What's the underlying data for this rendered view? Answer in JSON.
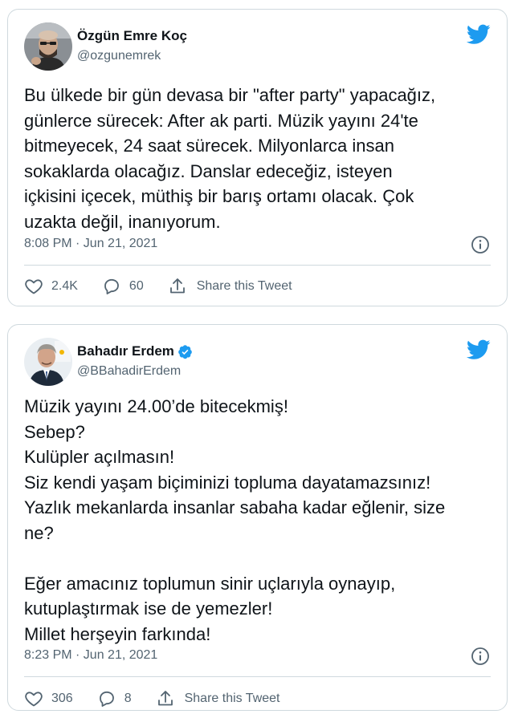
{
  "tweets": [
    {
      "author_name": "Özgün Emre Koç",
      "handle": "@ozgunemrek",
      "verified": false,
      "text": "Bu ülkede bir gün devasa bir \"after party\" yapacağız,\ngünlerce sürecek: After ak parti. Müzik yayını 24'te\nbitmeyecek, 24 saat sürecek. Milyonlarca insan\nsokaklarda olacağız. Danslar edeceğiz, isteyen\niçkisini içecek, müthiş bir barış ortamı olacak. Çok\nuzakta değil, inanıyorum.",
      "timestamp": "8:08 PM · Jun 21, 2021",
      "likes": "2.4K",
      "replies": "60",
      "share_label": "Share this Tweet"
    },
    {
      "author_name": "Bahadır Erdem",
      "handle": "@BBahadirErdem",
      "verified": true,
      "text": "Müzik yayını 24.00’de bitecekmiş!\nSebep?\nKulüpler açılmasın!\nSiz kendi yaşam biçiminizi topluma dayatamazsınız!\nYazlık mekanlarda insanlar sabaha kadar eğlenir, size\nne?\n\nEğer amacınız toplumun sinir uçlarıyla oynayıp,\nkutuplaştırmak ise de yemezler!\nMillet herşeyin farkında!",
      "timestamp": "8:23 PM · Jun 21, 2021",
      "likes": "306",
      "replies": "8",
      "share_label": "Share this Tweet"
    }
  ],
  "icons": {
    "brand": "twitter-bird-icon",
    "like": "heart-icon",
    "reply": "reply-bubble-icon",
    "share": "share-upload-icon",
    "info": "info-icon",
    "verified": "verified-badge-icon"
  },
  "colors": {
    "twitter_blue": "#1d9bf0",
    "text_primary": "#0f1419",
    "text_secondary": "#536471",
    "border": "#cfd9de"
  }
}
